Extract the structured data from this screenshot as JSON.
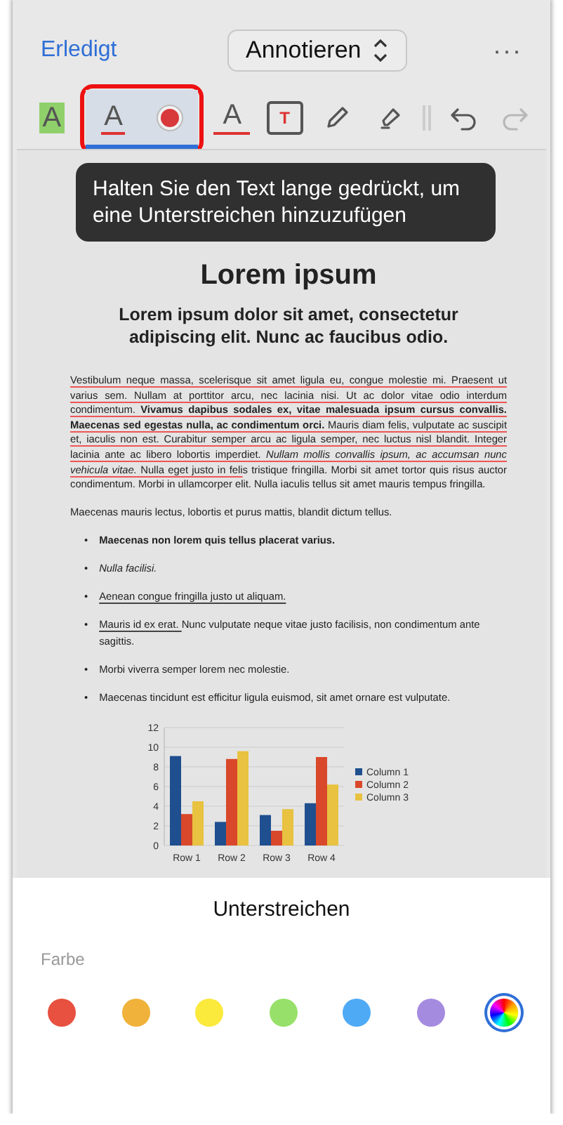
{
  "nav": {
    "done": "Erledigt",
    "mode": "Annotieren",
    "more": "···"
  },
  "tools": [
    {
      "kind": "highlight",
      "glyph": "A",
      "selected": false
    },
    {
      "kind": "underline",
      "glyph": "A",
      "selected": true
    },
    {
      "kind": "color",
      "selected": true
    },
    {
      "kind": "strike",
      "glyph": "A",
      "selected": false
    },
    {
      "kind": "textbox",
      "glyph": "T",
      "selected": false
    },
    {
      "kind": "pencil",
      "selected": false
    },
    {
      "kind": "marker",
      "selected": false
    },
    {
      "kind": "divider",
      "selected": false
    },
    {
      "kind": "undo",
      "selected": false,
      "disabled": false
    },
    {
      "kind": "redo",
      "selected": false,
      "disabled": true
    }
  ],
  "tooltip": "Halten Sie den Text lange gedrückt, um eine Unterstreichen hinzuzufügen",
  "document": {
    "title": "Lorem ipsum",
    "heading": "Lorem ipsum dolor sit amet, consectetur adipiscing elit. Nunc ac faucibus odio.",
    "paragraphs": [
      {
        "segments": [
          {
            "text": "Vestibulum neque massa, scelerisque sit amet ligula eu, congue molestie mi. Praesent ut varius sem. Nullam at porttitor arcu, nec lacinia nisi. Ut ac dolor vitae odio interdum condimentum. **Vivamus dapibus sodales ex, vitae malesuada ipsum cursus convallis. Maecenas sed egestas nulla, ac condimentum orci.** Mauris diam felis, vulputate ac suscipit et, iaculis non est. Curabitur semper arcu ac ligula semper, nec luctus nisl blandit. Integer lacinia ante ac libero lobortis imperdiet. *Nullam mollis convallis ipsum, ac accumsan nunc vehicula vitae.* Nulla eget justo in feli",
            "annotated": true
          },
          {
            "text": "s tristique fringilla. Morbi sit amet tortor quis risus auctor condimentum. Morbi in ullamcorper elit. Nulla iaculis tellus sit amet mauris tempus fringilla.",
            "annotated": false
          }
        ]
      },
      {
        "text": "Maecenas mauris lectus, lobortis et purus mattis, blandit dictum tellus."
      }
    ],
    "bullets": [
      {
        "marker": "•",
        "bold": true,
        "italic": false,
        "segments": [
          {
            "text": "Maecenas non lorem quis tellus placerat varius.",
            "underlined": false
          }
        ]
      },
      {
        "marker": "•",
        "bold": false,
        "italic": true,
        "segments": [
          {
            "text": "Nulla facilisi.",
            "underlined": false
          }
        ]
      },
      {
        "marker": "•",
        "bold": false,
        "italic": false,
        "segments": [
          {
            "text": "Aenean congue fringilla justo ut aliquam. ",
            "underlined": true
          }
        ]
      },
      {
        "marker": "•",
        "bold": false,
        "italic": false,
        "segments": [
          {
            "text": "Mauris id ex erat. ",
            "underlined": true
          },
          {
            "text": "Nunc vulputate neque vitae justo facilisis, non condimentum ante sagittis.",
            "underlined": false
          }
        ]
      },
      {
        "marker": "•",
        "bold": false,
        "italic": false,
        "segments": [
          {
            "text": "Morbi viverra semper lorem nec molestie.",
            "underlined": false
          }
        ]
      },
      {
        "marker": "•",
        "bold": false,
        "italic": false,
        "segments": [
          {
            "text": "Maecenas tincidunt est efficitur ligula euismod, sit amet ornare est vulputate.",
            "underlined": false
          }
        ]
      }
    ],
    "chart_data": {
      "type": "bar",
      "categories": [
        "Row 1",
        "Row 2",
        "Row 3",
        "Row 4"
      ],
      "ylim": [
        0,
        12
      ],
      "yticks": [
        0,
        2,
        4,
        6,
        8,
        10,
        12
      ],
      "grid": true,
      "legend": true,
      "series": [
        {
          "name": "Column 1",
          "color": "#1f4f8f",
          "values": [
            9.1,
            2.4,
            3.1,
            4.3
          ]
        },
        {
          "name": "Column 2",
          "color": "#d9482b",
          "values": [
            3.2,
            8.8,
            1.5,
            9.0
          ]
        },
        {
          "name": "Column 3",
          "color": "#e8c240",
          "values": [
            4.5,
            9.6,
            3.7,
            6.2
          ]
        }
      ]
    }
  },
  "sheet": {
    "title": "Unterstreichen",
    "label": "Farbe",
    "colors": [
      {
        "kind": "swatch",
        "color": "#e8503f",
        "selected": false
      },
      {
        "kind": "swatch",
        "color": "#f0b23a",
        "selected": false
      },
      {
        "kind": "swatch",
        "color": "#fbe93c",
        "selected": false
      },
      {
        "kind": "swatch",
        "color": "#97e06a",
        "selected": false
      },
      {
        "kind": "swatch",
        "color": "#4eaaf5",
        "selected": false
      },
      {
        "kind": "swatch",
        "color": "#a58be0",
        "selected": false
      },
      {
        "kind": "custom",
        "selected": true
      }
    ]
  }
}
